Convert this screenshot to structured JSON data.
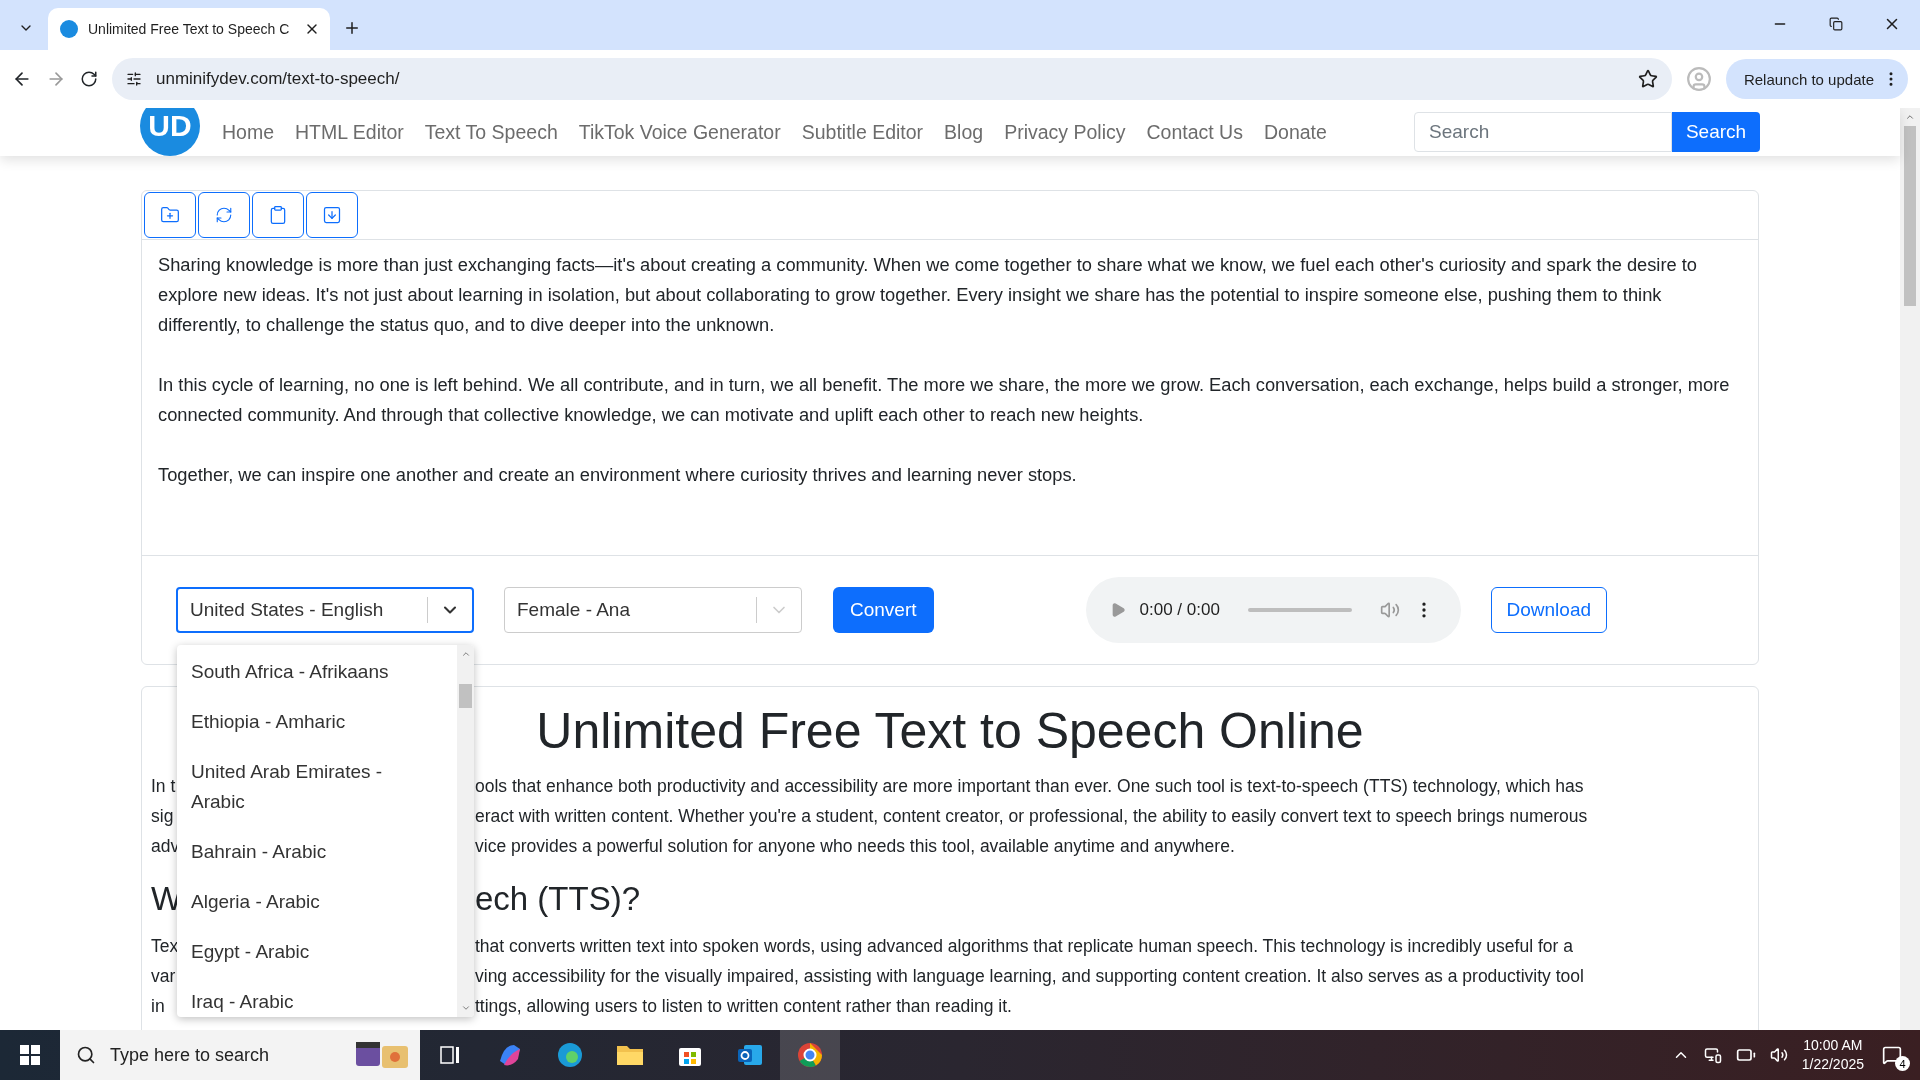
{
  "browser": {
    "tab_title": "Unlimited Free Text to Speech C",
    "url": "unminifydev.com/text-to-speech/",
    "relaunch_label": "Relaunch to update"
  },
  "site": {
    "logo_text": "UD",
    "nav": [
      "Home",
      "HTML Editor",
      "Text To Speech",
      "TikTok Voice Generator",
      "Subtitle Editor",
      "Blog",
      "Privacy Policy",
      "Contact Us",
      "Donate"
    ],
    "search": {
      "placeholder": "Search",
      "button": "Search"
    }
  },
  "editor": {
    "paragraphs": [
      "Sharing knowledge is more than just exchanging facts—it's about creating a community. When we come together to share what we know, we fuel each other's curiosity and spark the desire to explore new ideas. It's not just about learning in isolation, but about collaborating to grow together. Every insight we share has the potential to inspire someone else, pushing them to think differently, to challenge the status quo, and to dive deeper into the unknown.",
      "In this cycle of learning, no one is left behind. We all contribute, and in turn, we all benefit. The more we share, the more we grow. Each conversation, each exchange, helps build a stronger, more connected community. And through that collective knowledge, we can motivate and uplift each other to reach new heights.",
      "Together, we can inspire one another and create an environment where curiosity thrives and learning never stops."
    ]
  },
  "controls": {
    "language_select": {
      "value": "United States - English",
      "expanded": true
    },
    "voice_select": {
      "value": "Female - Ana"
    },
    "convert": "Convert",
    "audio": {
      "time": "0:00 / 0:00"
    },
    "download": "Download"
  },
  "language_options": [
    {
      "label": "South Africa - Afrikaans"
    },
    {
      "label": "Ethiopia - Amharic"
    },
    {
      "label": "United Arab Emirates - Arabic"
    },
    {
      "label": "Bahrain - Arabic"
    },
    {
      "label": "Algeria - Arabic"
    },
    {
      "label": "Egypt - Arabic"
    },
    {
      "label": "Iraq - Arabic"
    }
  ],
  "article": {
    "title": "Unlimited Free Text to Speech Online",
    "paragraph_1": [
      {
        "start": "In t",
        "rest": "ools that enhance both productivity and accessibility are more important than ever. One such tool is text-to-speech (TTS) technology, which has"
      },
      {
        "start": "sig",
        "rest": "eract with written content. Whether you're a student, content creator, or professional, the ability to easily convert text to speech brings numerous"
      },
      {
        "start": "adv",
        "rest": "vice provides a powerful solution for anyone who needs this tool, available anytime and anywhere."
      }
    ],
    "heading": {
      "start": "W",
      "rest": "ech (TTS)?"
    },
    "paragraph_2": [
      {
        "start": "Tex",
        "rest": "that converts written text into spoken words, using advanced algorithms that replicate human speech. This technology is incredibly useful for a"
      },
      {
        "start": "var",
        "rest": "ving accessibility for the visually impaired, assisting with language learning, and supporting content creation. It also serves as a productivity tool"
      },
      {
        "start": "in",
        "rest": "ttings, allowing users to listen to written content rather than reading it."
      }
    ]
  },
  "taskbar": {
    "search_placeholder": "Type here to search",
    "time": "10:00 AM",
    "date": "1/22/2025",
    "notification_count": "4"
  }
}
